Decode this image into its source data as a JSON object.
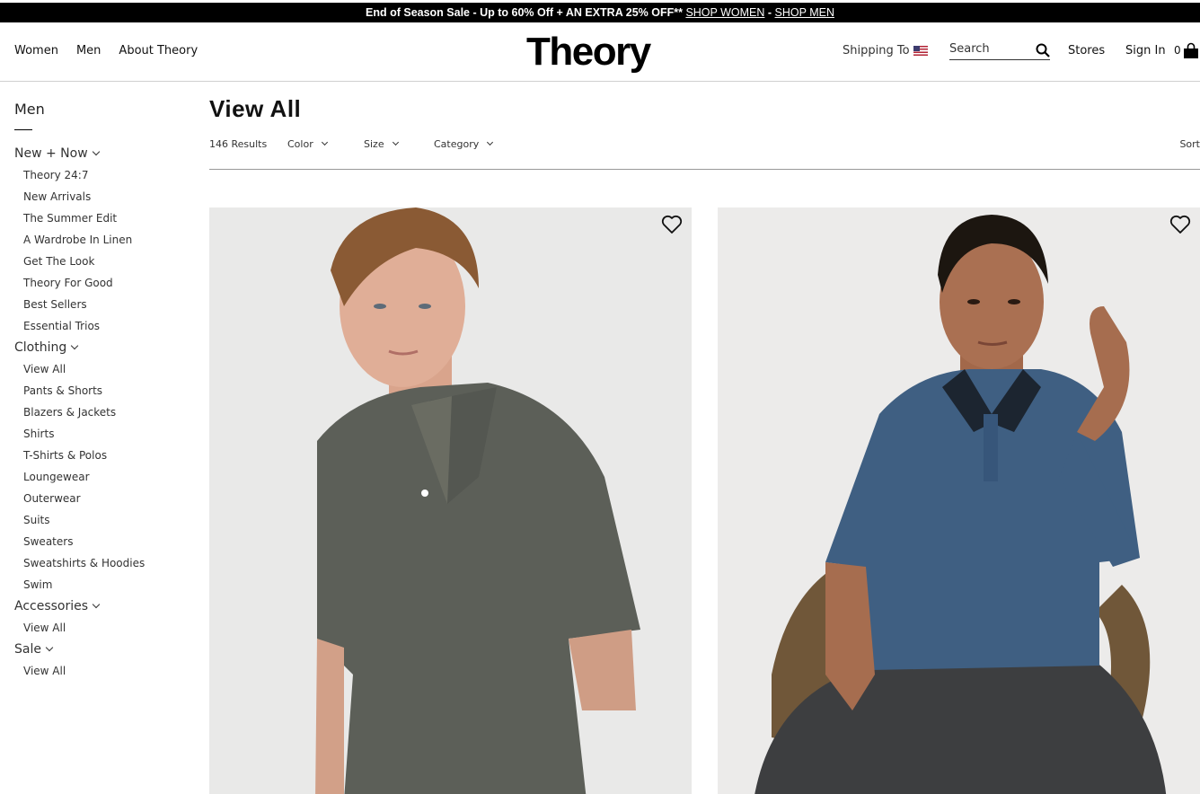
{
  "promo": {
    "text": "End of Season Sale - Up to 60% Off + AN EXTRA 25% OFF** ",
    "link_women": "SHOP WOMEN",
    "separator": " - ",
    "link_men": "SHOP MEN"
  },
  "header": {
    "nav": [
      "Women",
      "Men",
      "About Theory"
    ],
    "logo": "Theory",
    "shipping_label": "Shipping To",
    "search_placeholder": "Search",
    "stores": "Stores",
    "sign_in": "Sign In",
    "cart_count": "0"
  },
  "sidebar": {
    "title": "Men",
    "sections": [
      {
        "label": "New + Now",
        "items": [
          "Theory 24:7",
          "New Arrivals",
          "The Summer Edit",
          "A Wardrobe In Linen",
          "Get The Look",
          "Theory For Good",
          "Best Sellers",
          "Essential Trios"
        ]
      },
      {
        "label": "Clothing",
        "items": [
          "View All",
          "Pants & Shorts",
          "Blazers & Jackets",
          "Shirts",
          "T-Shirts & Polos",
          "Loungewear",
          "Outerwear",
          "Suits",
          "Sweaters",
          "Sweatshirts & Hoodies",
          "Swim"
        ]
      },
      {
        "label": "Accessories",
        "items": [
          "View All"
        ]
      },
      {
        "label": "Sale",
        "items": [
          "View All"
        ]
      }
    ]
  },
  "main": {
    "title": "View All",
    "results": "146 Results",
    "filters": [
      "Color",
      "Size",
      "Category"
    ],
    "sort": "Sort"
  },
  "products": [
    {
      "shirt_color": "#5c5f58",
      "icon": "heart-icon"
    },
    {
      "shirt_color": "#3f5f82",
      "icon": "heart-icon"
    }
  ]
}
